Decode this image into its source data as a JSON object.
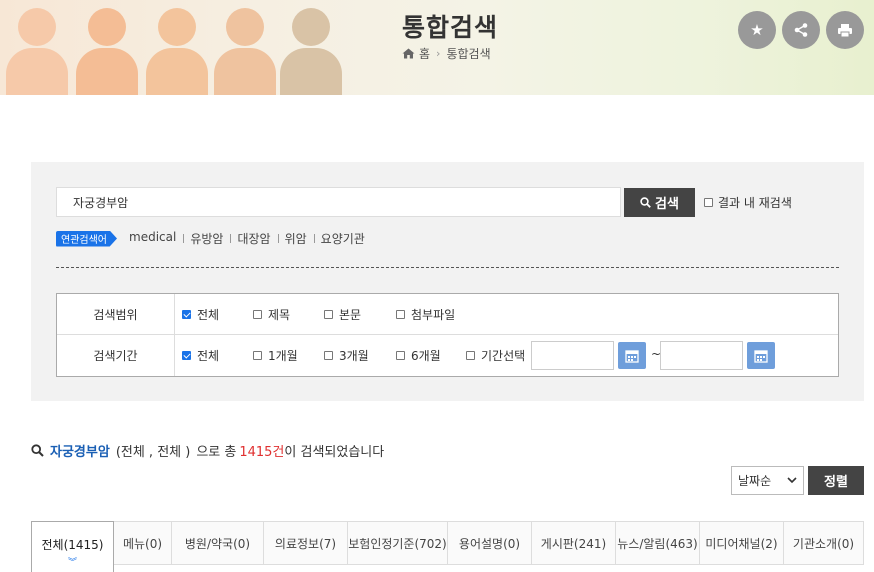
{
  "header": {
    "title": "통합검색",
    "breadcrumb": [
      "홈",
      "통합검색"
    ]
  },
  "top_buttons": [
    {
      "icon": "star-icon"
    },
    {
      "icon": "share-icon"
    },
    {
      "icon": "print-icon"
    }
  ],
  "search": {
    "value": "자궁경부암",
    "button_label": "검색",
    "inner_search_label": "결과 내 재검색",
    "inner_search_checked": false
  },
  "related": {
    "tag": "연관검색어",
    "keywords": [
      "medical",
      "유방암",
      "대장암",
      "위암",
      "요양기관"
    ]
  },
  "options": {
    "scope": {
      "label": "검색범위",
      "items": [
        {
          "label": "전체",
          "checked": true
        },
        {
          "label": "제목",
          "checked": false
        },
        {
          "label": "본문",
          "checked": false
        },
        {
          "label": "첨부파일",
          "checked": false
        }
      ]
    },
    "period": {
      "label": "검색기간",
      "items": [
        {
          "label": "전체",
          "checked": true
        },
        {
          "label": "1개월",
          "checked": false
        },
        {
          "label": "3개월",
          "checked": false
        },
        {
          "label": "6개월",
          "checked": false
        },
        {
          "label": "기간선택",
          "checked": false
        }
      ],
      "separator": "~"
    }
  },
  "summary": {
    "keyword": "자궁경부암",
    "filters": "(전체 , 전체 )",
    "middle": "으로 총",
    "count": "1415건",
    "suffix": "이 검색되었습니다"
  },
  "sort": {
    "selected": "날짜순",
    "button_label": "정렬"
  },
  "tabs": [
    {
      "label": "전체(1415)",
      "active": true
    },
    {
      "label": "메뉴(0)"
    },
    {
      "label": "병원/약국(0)"
    },
    {
      "label": "의료정보(7)"
    },
    {
      "label": "보험인정기준(702)"
    },
    {
      "label": "용어설명(0)"
    },
    {
      "label": "게시판(241)"
    },
    {
      "label": "뉴스/알림(463)"
    },
    {
      "label": "미디어채널(2)"
    },
    {
      "label": "기관소개(0)"
    }
  ],
  "colors": {
    "accent": "#1a73e8",
    "count": "#e03030",
    "dark_button": "#444444",
    "calendar_button": "#6f9edb"
  }
}
